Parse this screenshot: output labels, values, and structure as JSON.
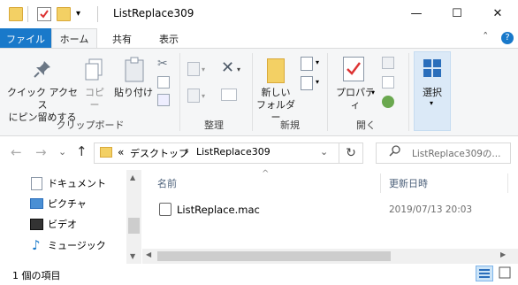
{
  "window": {
    "title": "ListReplace309",
    "minimize": "—",
    "maximize": "☐",
    "close": "✕"
  },
  "tabs": {
    "file": "ファイル",
    "home": "ホーム",
    "share": "共有",
    "view": "表示"
  },
  "ribbon": {
    "pin_label_1": "クイック アクセス",
    "pin_label_2": "にピン留めする",
    "copy_label": "コピー",
    "paste_label": "貼り付け",
    "group_clipboard": "クリップボード",
    "group_organize": "整理",
    "new_folder_1": "新しい",
    "new_folder_2": "フォルダー",
    "group_new": "新規",
    "properties_label": "プロパティ",
    "group_open": "開く",
    "select_label": "選択",
    "collapse": "ˆ",
    "help": "?"
  },
  "address": {
    "back": "←",
    "forward": "→",
    "recent": "⌄",
    "up": "↑",
    "overflow": "«",
    "crumb1": "デスクトップ",
    "sep": "›",
    "crumb2": "ListReplace309",
    "dropdown": "⌄",
    "refresh": "↻",
    "search_placeholder": "ListReplace309の..."
  },
  "nav": {
    "items": [
      {
        "label": "ドキュメント",
        "icon": "document-icon"
      },
      {
        "label": "ピクチャ",
        "icon": "picture-icon"
      },
      {
        "label": "ビデオ",
        "icon": "video-icon"
      },
      {
        "label": "ミュージック",
        "icon": "music-icon"
      }
    ]
  },
  "list": {
    "col_name": "名前",
    "col_date": "更新日時",
    "sort_indicator": "^",
    "files": [
      {
        "name": "ListReplace.mac",
        "date": "2019/07/13 20:03"
      }
    ]
  },
  "status": {
    "count": "1 個の項目"
  },
  "colors": {
    "accent": "#1979ca",
    "folder": "#f3d064",
    "ribbon_bg": "#f5f6f7"
  }
}
